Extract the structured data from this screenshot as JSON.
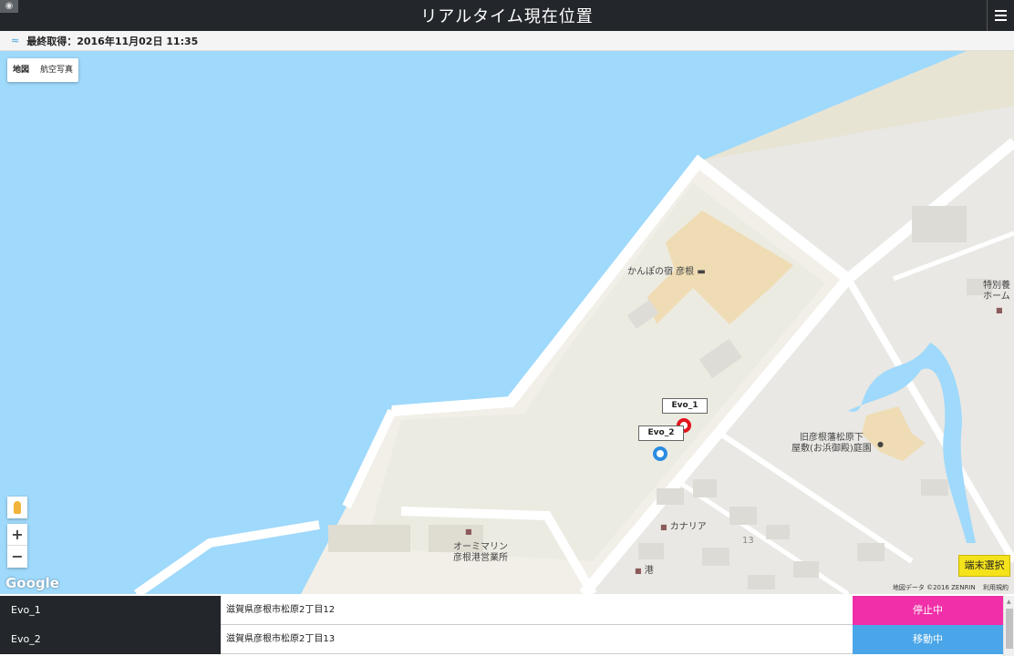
{
  "header": {
    "title": "リアルタイム現在位置"
  },
  "status": {
    "last_updated": "最終取得：2016年11月02日 11:35"
  },
  "map": {
    "type_buttons": [
      "地図",
      "航空写真"
    ],
    "zoom_in": "+",
    "zoom_out": "−",
    "google_logo": "Google",
    "map_data_credit": "地図データ ©2016 ZENRIN",
    "terms": "利用規約",
    "select_device_button": "端末選択",
    "place_labels": {
      "hotel": "かんぽの宿 彦根",
      "garden_line1": "旧彦根藩松原下",
      "garden_line2": "屋敷(お浜御殿)庭園",
      "marina_line1": "オーミマリン",
      "marina_line2": "彦根港営業所",
      "canaria": "カナリア",
      "port": "港",
      "block_number": "13",
      "special_line1": "特別養",
      "special_line2": "ホーム"
    },
    "markers": [
      {
        "label": "Evo_1",
        "color": "#e0161d"
      },
      {
        "label": "Evo_2",
        "color": "#2b8ce0"
      }
    ],
    "colors": {
      "water": "#9fd9fb",
      "land": "#eceae6",
      "road": "#ffffff",
      "beach": "#e8e4d4"
    }
  },
  "devices": [
    {
      "name": "Evo_1",
      "address": "滋賀県彦根市松原2丁目12",
      "status": "停止中",
      "status_color": "#f02fa8"
    },
    {
      "name": "Evo_2",
      "address": "滋賀県彦根市松原2丁目13",
      "status": "移動中",
      "status_color": "#4aa6e8"
    }
  ]
}
